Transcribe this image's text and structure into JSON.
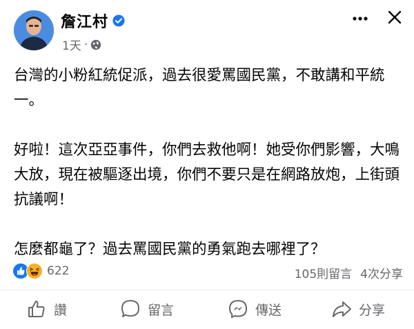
{
  "post": {
    "author": "詹江村",
    "time": "1天",
    "paragraphs": [
      "台灣的小粉紅統促派，過去很愛罵國民黨，不敢講和平統一。",
      "好啦！這次亞亞事件，你們去救他啊！她受你們影響，大鳴大放，現在被驅逐出境，你們不要只是在網路放炮，上街頭抗議啊！",
      "怎麼都龜了？過去罵國民黨的勇氣跑去哪裡了？"
    ]
  },
  "stats": {
    "reactions": "622",
    "comments": "105則留言",
    "shares": "4次分享"
  },
  "actions": {
    "like": "讚",
    "comment": "留言",
    "send": "傳送",
    "share": "分享"
  },
  "colors": {
    "fb_blue": "#1877f2",
    "secondary_text": "#65676b",
    "haha_yellow": "#f7b125"
  },
  "icons": {
    "verified": "verified-badge-icon",
    "privacy": "globe-icon",
    "like": "thumbs-up-icon",
    "comment": "comment-bubble-icon",
    "send": "messenger-icon",
    "share": "share-arrow-icon"
  }
}
